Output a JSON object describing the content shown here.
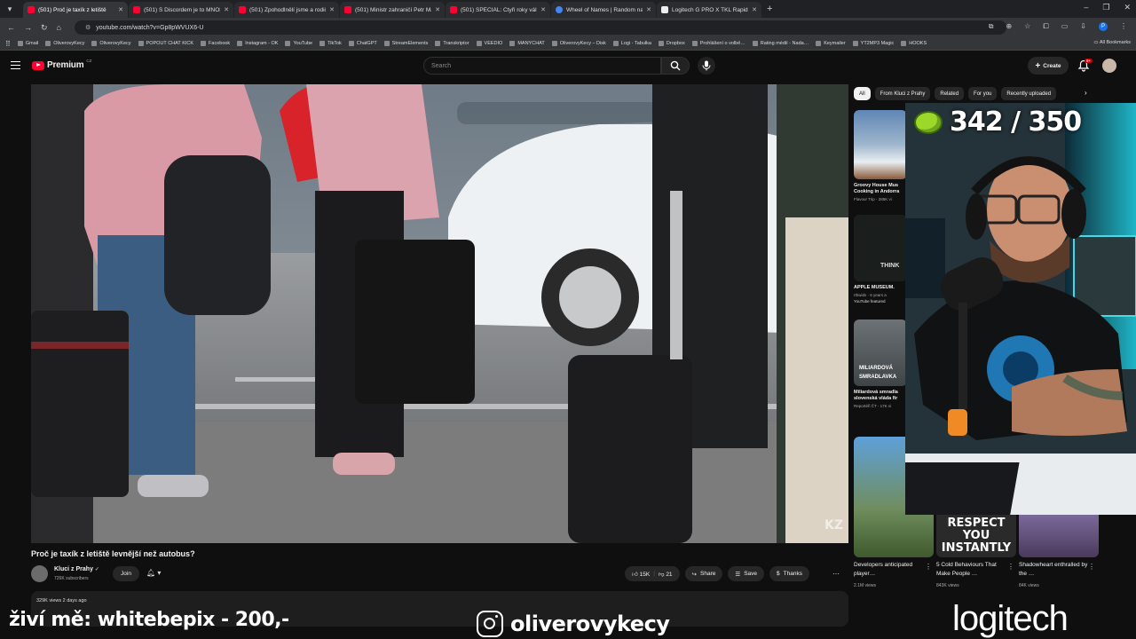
{
  "browser": {
    "tabs": [
      {
        "label": "(501) Proč je taxík z letiště",
        "icon": "youtube-icon",
        "active": true
      },
      {
        "label": "(501) S Discordem je to MNOH",
        "icon": "youtube-icon",
        "active": false
      },
      {
        "label": "(501) Zpohodlnělí jsme a rodič",
        "icon": "youtube-icon",
        "active": false
      },
      {
        "label": "(501) Ministr zahraničí Petr Ma",
        "icon": "youtube-icon",
        "active": false
      },
      {
        "label": "(501) SPECIÁL: Čtyři roky války",
        "icon": "youtube-icon",
        "active": false
      },
      {
        "label": "Wheel of Names | Random nam",
        "icon": "wheel-icon",
        "active": false
      },
      {
        "label": "Logitech G PRO X TKL Rapid, b",
        "icon": "logitech-icon",
        "active": false
      }
    ],
    "url": "youtube.com/watch?v=Gp8pWVUX6-U",
    "bookmarks": [
      "Gmail",
      "OliverovyKecy",
      "OliverovyKecy",
      "POPOUT CHAT KICK",
      "Facebook",
      "Instagram - OK",
      "YouTube",
      "TikTok",
      "ChatGPT",
      "StreamElements",
      "Transkriptor",
      "VEEDIO",
      "MANYCHAT",
      "OliverovyKecy – Disk",
      "Logi - Tabulka",
      "Dropbox",
      "Prohlášení o volbě…",
      "Rating médií - Nada…",
      "Keymailer",
      "YT2MP3 Magic",
      "HOOKS"
    ],
    "all_bookmarks": "All Bookmarks",
    "profile_initial": "P"
  },
  "yt": {
    "logo_text": "Premium",
    "logo_region": "CZ",
    "search_placeholder": "Search",
    "create_label": "Create",
    "notif_badge": "9+"
  },
  "video": {
    "title": "Proč je taxík z letiště levnější než autobus?",
    "channel": "Kluci z Prahy",
    "subscribers": "726K subscribers",
    "join_label": "Join",
    "likes": "15K",
    "dislikes": "21",
    "share_label": "Share",
    "save_label": "Save",
    "thanks_label": "Thanks",
    "views_line": "329K views  2 days ago",
    "watermark": "KZ"
  },
  "sidebar": {
    "chips": [
      {
        "label": "All",
        "active": true
      },
      {
        "label": "From Kluci z Prahy",
        "active": false
      },
      {
        "label": "Related",
        "active": false
      },
      {
        "label": "For you",
        "active": false
      },
      {
        "label": "Recently uploaded",
        "active": false
      }
    ],
    "videos": [
      {
        "title": "Groovy House Mus Cooking in Andorra",
        "meta": "Flavour Trip - 285K vi"
      },
      {
        "title": "APPLE MUSEUM.",
        "meta": "rthwids · 6 years a",
        "badge": "YouTube featured"
      },
      {
        "title": "Miliardová smradla slovenská vláda fir",
        "meta": "Reportéři ČT - 17K vi",
        "thumb_text1": "MILIARDOVÁ",
        "thumb_text2": "SMRADLAVKA"
      }
    ],
    "thumb_think": "THINK",
    "shorts": [
      {
        "title": "Developers anticipated player…",
        "views": "2.1M views"
      },
      {
        "title": "5 Cold Behaviours That Make People …",
        "views": "843K views",
        "thumb_text": "RESPECT YOU INSTANTLY"
      },
      {
        "title": "Shadowheart enthralled by the …",
        "views": "84K views"
      }
    ]
  },
  "overlay": {
    "counter": "342 / 350",
    "donate_text": "živí mě: whitebepix - 200,-",
    "instagram_handle": "oliverovykecy",
    "sponsor": "logitech"
  }
}
